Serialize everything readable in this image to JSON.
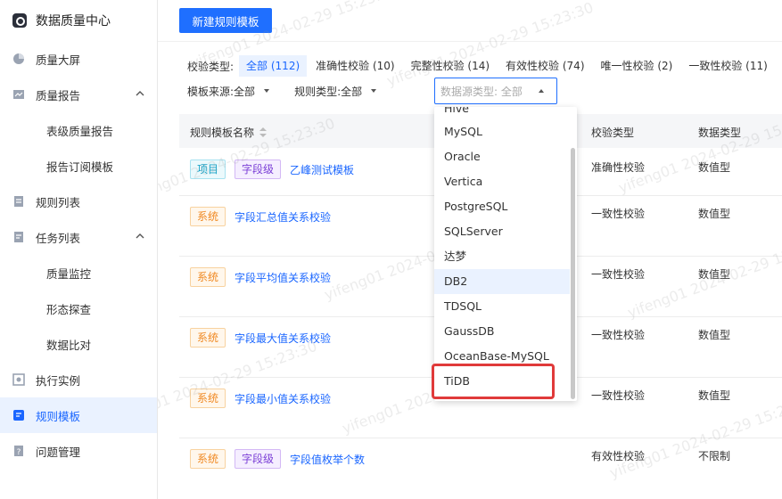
{
  "app": {
    "title": "数据质量中心"
  },
  "sidebar": {
    "items": [
      {
        "label": "质量大屏",
        "icon": "pie-chart-icon"
      },
      {
        "label": "质量报告",
        "icon": "report-icon",
        "expandable": true
      },
      {
        "label": "表级质量报告",
        "sub": true
      },
      {
        "label": "报告订阅模板",
        "sub": true
      },
      {
        "label": "规则列表",
        "icon": "rule-list-icon"
      },
      {
        "label": "任务列表",
        "icon": "task-list-icon",
        "expandable": true
      },
      {
        "label": "质量监控",
        "sub": true
      },
      {
        "label": "形态探查",
        "sub": true
      },
      {
        "label": "数据比对",
        "sub": true
      },
      {
        "label": "执行实例",
        "icon": "instance-icon"
      },
      {
        "label": "规则模板",
        "icon": "template-icon",
        "active": true
      },
      {
        "label": "问题管理",
        "icon": "issue-icon"
      }
    ]
  },
  "toolbar": {
    "new_template": "新建规则模板"
  },
  "filters": {
    "check_type_label": "校验类型:",
    "check_types": [
      "全部 (112)",
      "准确性校验 (10)",
      "完整性校验 (14)",
      "有效性校验 (74)",
      "唯一性校验 (2)",
      "一致性校验 (11)"
    ],
    "source_label": "模板来源:",
    "source_value": "全部",
    "rule_type_label": "规则类型:",
    "rule_type_value": "全部",
    "datasource_placeholder": "数据源类型: 全部"
  },
  "table": {
    "headers": {
      "name": "规则模板名称",
      "check_type": "校验类型",
      "data_type": "数据类型"
    },
    "rows": [
      {
        "tags": [
          "项目",
          "字段级"
        ],
        "name": "乙峰测试模板",
        "check_type": "准确性校验",
        "data_type": "数值型"
      },
      {
        "tags": [
          "系统"
        ],
        "name": "字段汇总值关系校验",
        "check_type": "一致性校验",
        "data_type": "数值型"
      },
      {
        "tags": [
          "系统"
        ],
        "name": "字段平均值关系校验",
        "check_type": "一致性校验",
        "data_type": "数值型"
      },
      {
        "tags": [
          "系统"
        ],
        "name": "字段最大值关系校验",
        "check_type": "一致性校验",
        "data_type": "数值型"
      },
      {
        "tags": [
          "系统"
        ],
        "name": "字段最小值关系校验",
        "check_type": "一致性校验",
        "data_type": "数值型"
      },
      {
        "tags": [
          "系统",
          "字段级"
        ],
        "name": "字段值枚举个数",
        "check_type": "有效性校验",
        "data_type": "不限制"
      }
    ]
  },
  "dropdown": {
    "options": [
      "Hive",
      "MySQL",
      "Oracle",
      "Vertica",
      "PostgreSQL",
      "SQLServer",
      "达梦",
      "DB2",
      "TDSQL",
      "GaussDB",
      "OceanBase-MySQL",
      "TiDB"
    ],
    "highlighted": "DB2"
  },
  "watermark": "yifeng01 2024-02-29 15:23:30",
  "colors": {
    "primary": "#1f6fff",
    "annotation": "#e03a3a"
  }
}
